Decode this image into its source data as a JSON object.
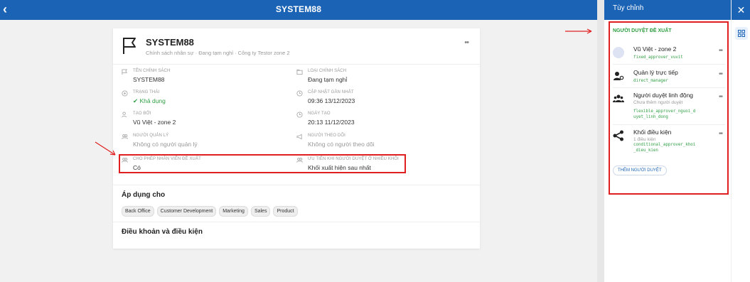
{
  "header": {
    "back_icon": "chevron-left-icon",
    "title": "SYSTEM88"
  },
  "card": {
    "title": "SYSTEM88",
    "subtitle": "Chính sách nhân sự · Đang tạm nghỉ · Công ty Testor zone 2",
    "fields": {
      "policy_name_label": "TÊN CHÍNH SÁCH",
      "policy_name_value": "SYSTEM88",
      "policy_type_label": "LOẠI CHÍNH SÁCH",
      "policy_type_value": "Đang tạm nghỉ",
      "status_label": "TRẠNG THÁI",
      "status_value": "Khả dụng",
      "updated_label": "CẬP NHẬT GẦN NHẤT",
      "updated_value": "09:36 13/12/2023",
      "created_by_label": "TẠO BỞI",
      "created_by_value": "Vũ Việt - zone 2",
      "created_at_label": "NGÀY TẠO",
      "created_at_value": "20:13 11/12/2023",
      "manager_label": "NGƯỜI QUẢN LÝ",
      "manager_value": "Không có người quản lý",
      "follower_label": "NGƯỜI THEO DÕI",
      "follower_value": "Không có người theo dõi",
      "allow_suggest_label": "CHO PHÉP NHÂN VIÊN ĐỀ XUẤT",
      "allow_suggest_value": "Có",
      "priority_label": "ƯU TIÊN KHI NGƯỜI DUYỆT Ở NHIỀU KHỐI",
      "priority_value": "Khối xuất hiện sau nhất"
    },
    "apply_title": "Áp dụng cho",
    "apply_chips": [
      "Back Office",
      "Customer Development",
      "Marketing",
      "Sales",
      "Product"
    ],
    "terms_title": "Điều khoản và điều kiện"
  },
  "panel": {
    "title": "Tùy chỉnh",
    "section_label": "NGƯỜI DUYỆT ĐỀ XUẤT",
    "approvers": [
      {
        "name": "Vũ Việt - zone 2",
        "code": "fixed_approver_vuvit",
        "icon": "avatar-icon"
      },
      {
        "name": "Quản lý trực tiếp",
        "code": "direct_manager",
        "icon": "manager-icon"
      },
      {
        "name": "Người duyệt linh động",
        "sub": "Chưa thêm người duyệt",
        "code": "flexible_approver_nguoi_d\nuyet_linh_dong",
        "icon": "group-icon"
      },
      {
        "name": "Khối điều kiện",
        "sub": "1 điều kiện",
        "code": "conditional_approver_khoi\n_dieu_kien",
        "icon": "share-nodes-icon"
      }
    ],
    "add_button": "THÊM NGƯỜI DUYỆT"
  },
  "accent": "#1a63b5",
  "highlight_color": "#e02020"
}
